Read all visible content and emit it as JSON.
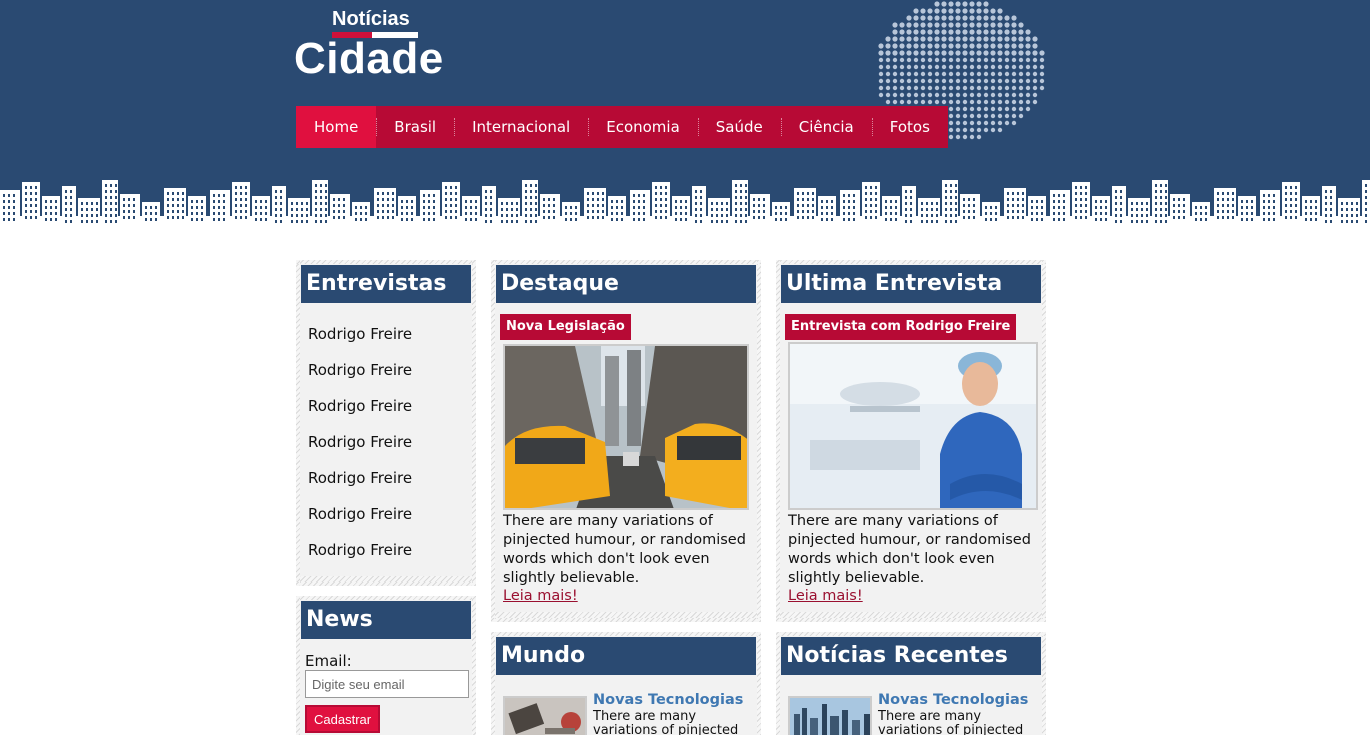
{
  "logo": {
    "top": "Notícias",
    "main": "Cidade"
  },
  "nav": [
    {
      "label": "Home",
      "active": true
    },
    {
      "label": "Brasil"
    },
    {
      "label": "Internacional"
    },
    {
      "label": "Economia"
    },
    {
      "label": "Saúde"
    },
    {
      "label": "Ciência"
    },
    {
      "label": "Fotos"
    }
  ],
  "entrevistas": {
    "title": "Entrevistas",
    "items": [
      "Rodrigo Freire",
      "Rodrigo Freire",
      "Rodrigo Freire",
      "Rodrigo Freire",
      "Rodrigo Freire",
      "Rodrigo Freire",
      "Rodrigo Freire"
    ]
  },
  "news": {
    "title": "News",
    "email_label": "Email:",
    "email_placeholder": "Digite seu email",
    "submit_label": "Cadastrar"
  },
  "destaque": {
    "title": "Destaque",
    "tag": "Nova Legislação",
    "text": "There are many variations of pinjected humour, or randomised words which don't look even slightly believable.",
    "link": "Leia mais!"
  },
  "ultima": {
    "title": "Ultima Entrevista",
    "tag": "Entrevista com Rodrigo Freire",
    "text": "There are many variations of pinjected humour, or randomised words which don't look even slightly believable.",
    "link": "Leia mais!"
  },
  "mundo": {
    "title": "Mundo",
    "item_title": "Novas Tecnologias",
    "item_text": "There are many variations of pinjected"
  },
  "recentes": {
    "title": "Notícias Recentes",
    "item_title": "Novas Tecnologias",
    "item_text": "There are many variations of pinjected"
  },
  "colors": {
    "navy": "#2a4a72",
    "red": "#b70a35",
    "red_active": "#e0103f"
  }
}
